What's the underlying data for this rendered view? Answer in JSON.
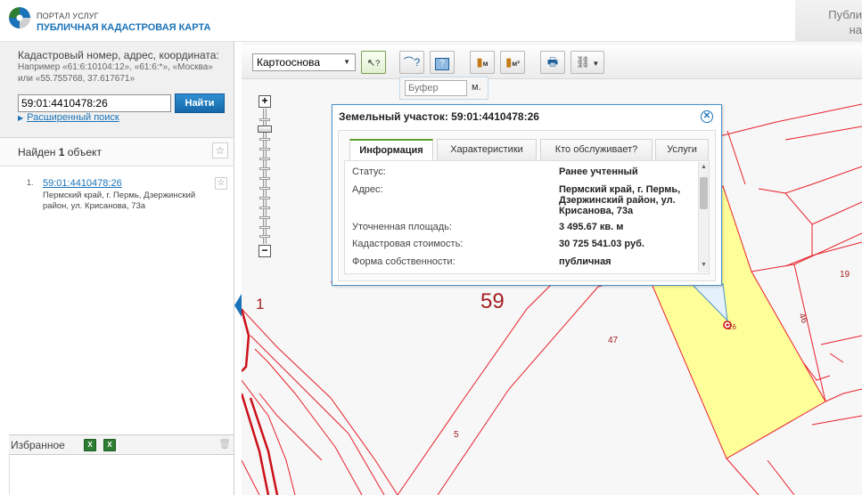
{
  "header": {
    "logo_top": "ПОРТАЛ УСЛУГ",
    "logo_main": "ПУБЛИЧНАЯ КАДАСТРОВАЯ КАРТА",
    "right_line1": "Публи",
    "right_line2": "на"
  },
  "search": {
    "title": "Кадастровый номер, адрес, координата:",
    "hint": "Например «61:6:10104:12», «61:6:*», «Москва» или «55.755768, 37.617671»",
    "value": "59:01:4410478:26",
    "button": "Найти",
    "advanced": "Расширенный поиск"
  },
  "results": {
    "found_prefix": "Найден",
    "found_count": "1",
    "found_suffix": "объект",
    "items": [
      {
        "num": "1.",
        "cadastral": "59:01:4410478:26",
        "address": "Пермский край, г. Пермь, Дзержинский район, ул. Крисанова, 73а"
      }
    ]
  },
  "favorites": {
    "label": "Избранное"
  },
  "toolbar": {
    "layer": "Картооснова",
    "buffer_placeholder": "Буфер",
    "buffer_unit": "м.",
    "m_sub": "м",
    "m2_sub": "м²"
  },
  "popup": {
    "title": "Земельный участок: 59:01:4410478:26",
    "tabs": [
      "Информация",
      "Характеристики",
      "Кто обслуживает?",
      "Услуги"
    ],
    "rows": [
      {
        "k": "Статус:",
        "v": "Ранее учтенный"
      },
      {
        "k": "Адрес:",
        "v": "Пермский край, г. Пермь, Дзержинский район, ул. Крисанова, 73а"
      },
      {
        "k": "Уточненная площадь:",
        "v": "3 495.67 кв. м"
      },
      {
        "k": "Кадастровая стоимость:",
        "v": "30 725 541.03 руб."
      },
      {
        "k": "Форма собственности:",
        "v": "публичная"
      }
    ]
  },
  "map": {
    "labels": {
      "quarter": "59",
      "left_1": "1",
      "lot_47": "47",
      "lot_19": "19",
      "lot_46": "46",
      "lot_5": "5",
      "lot_26": "26"
    },
    "colors": {
      "boundary": "#e8202a",
      "selected_fill": "#ffff99",
      "accent": "#1a73b8"
    }
  }
}
